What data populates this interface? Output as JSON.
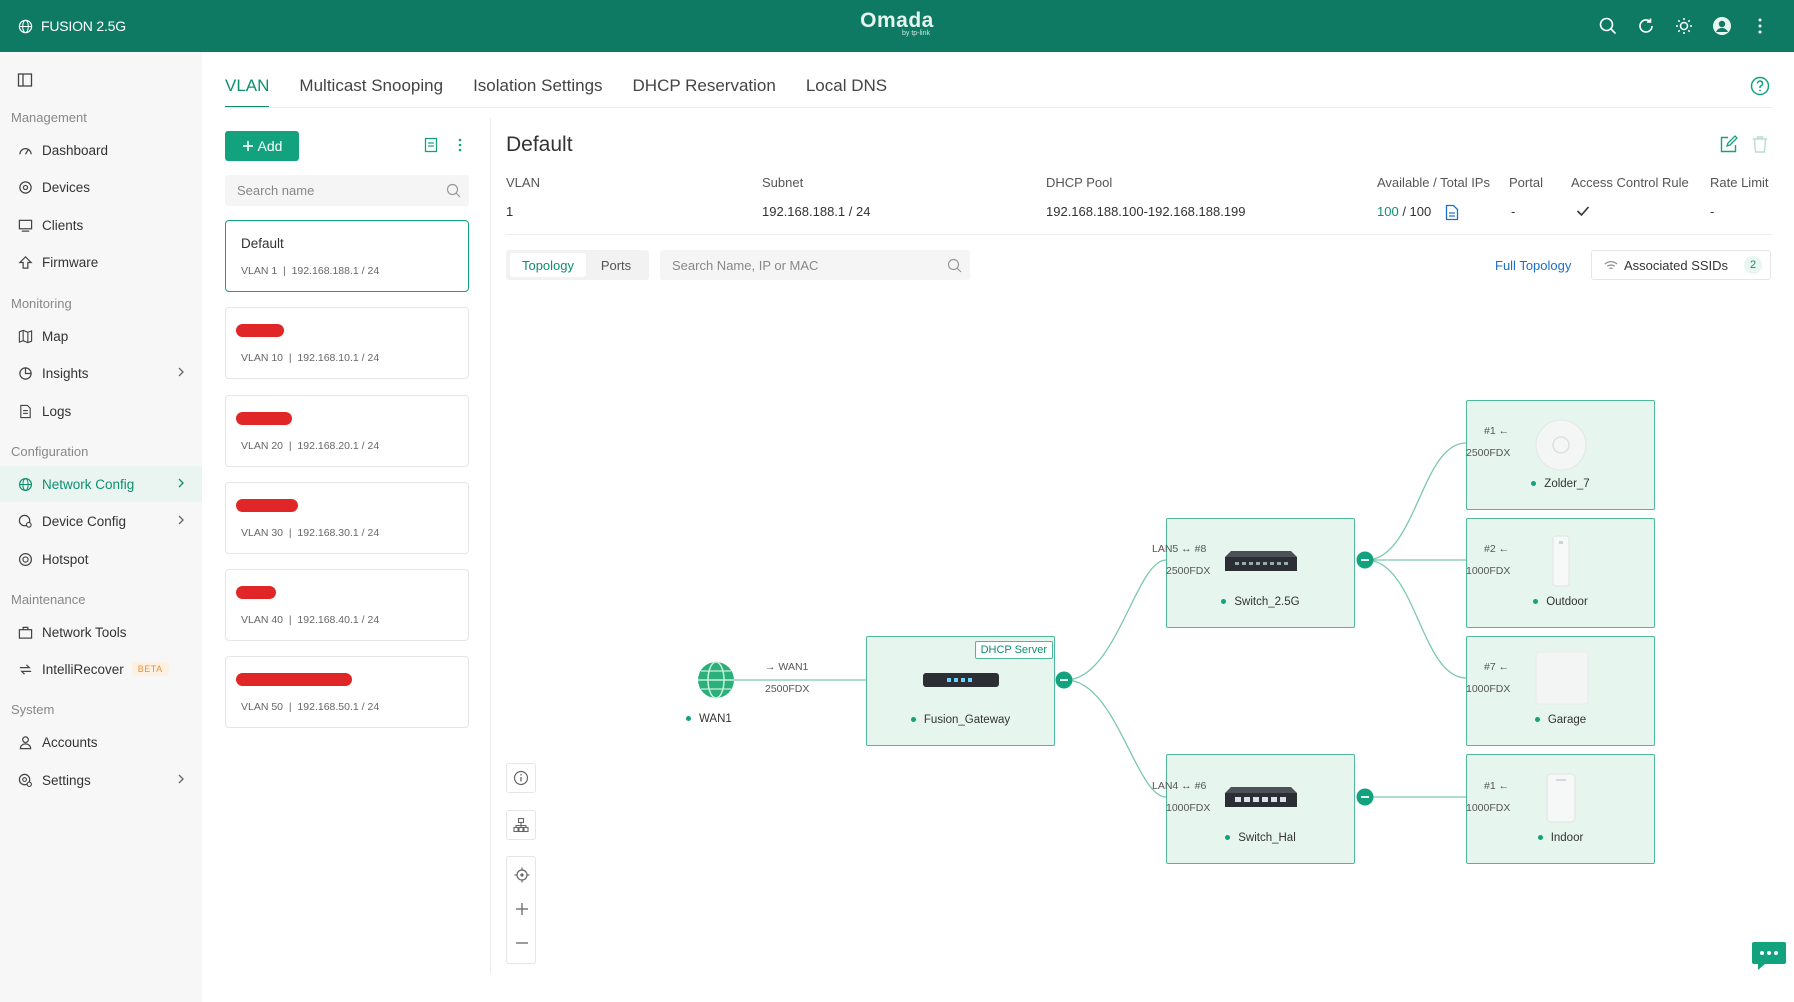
{
  "header": {
    "site_name": "FUSION 2.5G",
    "brand": "Omada",
    "brand_sub": "by tp-link"
  },
  "sidebar": {
    "sections": {
      "management": "Management",
      "monitoring": "Monitoring",
      "configuration": "Configuration",
      "maintenance": "Maintenance",
      "system": "System"
    },
    "items": [
      {
        "label": "Dashboard",
        "icon": "dashboard-icon"
      },
      {
        "label": "Devices",
        "icon": "devices-icon"
      },
      {
        "label": "Clients",
        "icon": "clients-icon"
      },
      {
        "label": "Firmware",
        "icon": "firmware-icon"
      },
      {
        "label": "Map",
        "icon": "map-icon"
      },
      {
        "label": "Insights",
        "icon": "insights-icon"
      },
      {
        "label": "Logs",
        "icon": "logs-icon"
      },
      {
        "label": "Network Config",
        "icon": "network-icon",
        "active": true
      },
      {
        "label": "Device Config",
        "icon": "device-config-icon"
      },
      {
        "label": "Hotspot",
        "icon": "hotspot-icon"
      },
      {
        "label": "Network Tools",
        "icon": "toolbox-icon"
      },
      {
        "label": "IntelliRecover",
        "icon": "recover-icon",
        "badge": "BETA"
      },
      {
        "label": "Accounts",
        "icon": "user-icon"
      },
      {
        "label": "Settings",
        "icon": "settings-icon"
      }
    ]
  },
  "tabs": [
    "VLAN",
    "Multicast Snooping",
    "Isolation Settings",
    "DHCP Reservation",
    "Local DNS"
  ],
  "vlan_list": {
    "add_label": "Add",
    "search_placeholder": "Search name",
    "items": [
      {
        "name": "Default",
        "sub": "VLAN 1  |  192.168.188.1 / 24"
      },
      {
        "name": "",
        "sub": "VLAN 10  |  192.168.10.1 / 24"
      },
      {
        "name": "",
        "sub": "VLAN 20  |  192.168.20.1 / 24"
      },
      {
        "name": "",
        "sub": "VLAN 30  |  192.168.30.1 / 24"
      },
      {
        "name": "",
        "sub": "VLAN 40  |  192.168.40.1 / 24"
      },
      {
        "name": "",
        "sub": "VLAN 50  |  192.168.50.1 / 24"
      }
    ]
  },
  "detail": {
    "title": "Default",
    "headers": {
      "vlan": "VLAN",
      "subnet": "Subnet",
      "dhcp_pool": "DHCP Pool",
      "available": "Available / Total IPs",
      "portal": "Portal",
      "acl": "Access Control Rule",
      "rate_limit": "Rate Limit"
    },
    "values": {
      "vlan": "1",
      "subnet": "192.168.188.1 / 24",
      "dhcp_pool": "192.168.188.100-192.168.188.199",
      "available": "100",
      "total": "/ 100",
      "portal": "-",
      "rate_limit": "-"
    },
    "view_tabs": [
      "Topology",
      "Ports"
    ],
    "topo_search_placeholder": "Search Name, IP or MAC",
    "full_topology": "Full Topology",
    "ssids_label": "Associated SSIDs",
    "ssids_count": "2"
  },
  "topology": {
    "wan": {
      "label": "WAN1",
      "port_dir": "→ WAN1",
      "speed": "2500FDX"
    },
    "gateway": {
      "label": "Fusion_Gateway",
      "badge": "DHCP Server"
    },
    "switches": [
      {
        "label": "Switch_2.5G",
        "port": "LAN5 ↔ #8",
        "speed": "2500FDX"
      },
      {
        "label": "Switch_Hal",
        "port": "LAN4 ↔ #6",
        "speed": "1000FDX"
      }
    ],
    "aps": [
      {
        "label": "Zolder_7",
        "port": "#1 ←",
        "speed": "2500FDX"
      },
      {
        "label": "Outdoor",
        "port": "#2 ←",
        "speed": "1000FDX"
      },
      {
        "label": "Garage",
        "port": "#7 ←",
        "speed": "1000FDX"
      },
      {
        "label": "Indoor",
        "port": "#1 ←",
        "speed": "1000FDX"
      }
    ]
  },
  "colors": {
    "brand": "#0e7a64",
    "accent": "#12a37e",
    "redaction": "#e02626"
  }
}
